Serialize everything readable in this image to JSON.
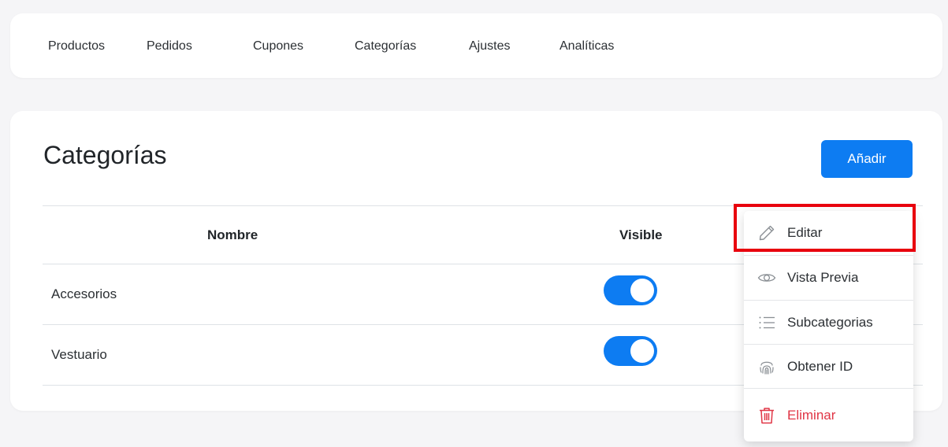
{
  "nav": {
    "items": [
      {
        "label": "Productos"
      },
      {
        "label": "Pedidos"
      },
      {
        "label": "Cupones"
      },
      {
        "label": "Categorías"
      },
      {
        "label": "Ajustes"
      },
      {
        "label": "Analíticas"
      }
    ]
  },
  "page": {
    "title": "Categorías",
    "add_label": "Añadir"
  },
  "table": {
    "headers": {
      "name": "Nombre",
      "visible": "Visible"
    },
    "rows": [
      {
        "name": "Accesorios",
        "visible": true
      },
      {
        "name": "Vestuario",
        "visible": true
      }
    ]
  },
  "menu": {
    "items": [
      {
        "label": "Editar",
        "icon": "pencil-icon"
      },
      {
        "label": "Vista Previa",
        "icon": "eye-icon"
      },
      {
        "label": "Subcategorias",
        "icon": "list-icon"
      },
      {
        "label": "Obtener ID",
        "icon": "fingerprint-icon"
      },
      {
        "label": "Eliminar",
        "icon": "trash-icon"
      }
    ]
  },
  "colors": {
    "accent": "#0d7cf2",
    "danger": "#e03545",
    "highlight": "#e8000d"
  }
}
